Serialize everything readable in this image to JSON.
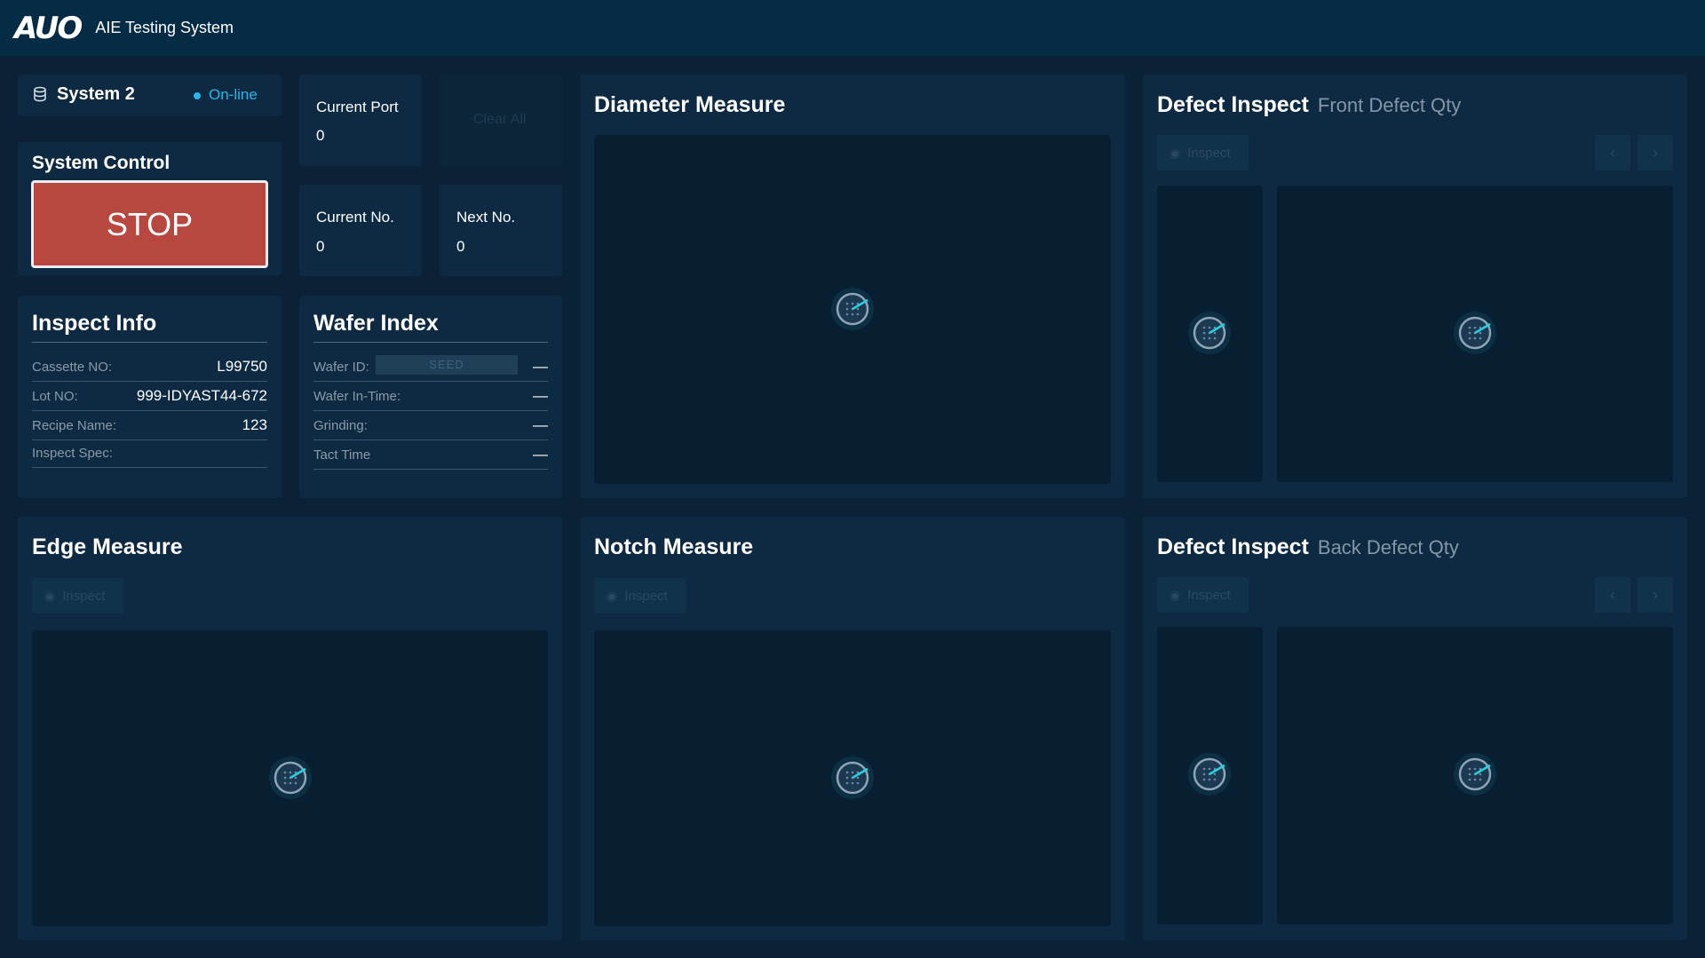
{
  "header": {
    "logo_text": "AUO",
    "app_title": "AIE Testing System"
  },
  "system": {
    "name": "System 2",
    "status": "On-line",
    "status_color": "#29b6e8"
  },
  "control": {
    "title": "System Control",
    "stop_label": "STOP",
    "stop_color": "#b7473f"
  },
  "counters": {
    "current_port_label": "Current Port",
    "current_port_value": "0",
    "clear_all_label": "Clear All",
    "current_no_label": "Current No.",
    "current_no_value": "0",
    "next_no_label": "Next No.",
    "next_no_value": "0"
  },
  "inspect_info": {
    "title": "Inspect Info",
    "rows": [
      {
        "label": "Cassette NO:",
        "value": "L99750"
      },
      {
        "label": "Lot NO:",
        "value": "999-IDYAST44-672"
      },
      {
        "label": "Recipe Name:",
        "value": "123"
      },
      {
        "label": "Inspect Spec:",
        "value": ""
      }
    ]
  },
  "wafer_index": {
    "title": "Wafer Index",
    "wafer_id_chip": "SEED",
    "rows": [
      {
        "label": "Wafer ID:",
        "value": "—"
      },
      {
        "label": "Wafer In-Time:",
        "value": "—"
      },
      {
        "label": "Grinding:",
        "value": "—"
      },
      {
        "label": "Tact Time",
        "value": "—"
      }
    ]
  },
  "diameter": {
    "title": "Diameter Measure"
  },
  "defect_front": {
    "title": "Defect Inspect",
    "subtitle": "Front Defect Qty",
    "inspect_label": "Inspect"
  },
  "edge": {
    "title": "Edge Measure",
    "inspect_label": "Inspect"
  },
  "notch": {
    "title": "Notch Measure",
    "inspect_label": "Inspect"
  },
  "defect_back": {
    "title": "Defect Inspect",
    "subtitle": "Back Defect Qty",
    "inspect_label": "Inspect"
  },
  "nav": {
    "prev_icon": "chevron-left-icon",
    "next_icon": "chevron-right-icon"
  },
  "icons": {
    "loader": "wafer-loading-icon",
    "eye": "eye-icon",
    "db": "database-icon"
  }
}
